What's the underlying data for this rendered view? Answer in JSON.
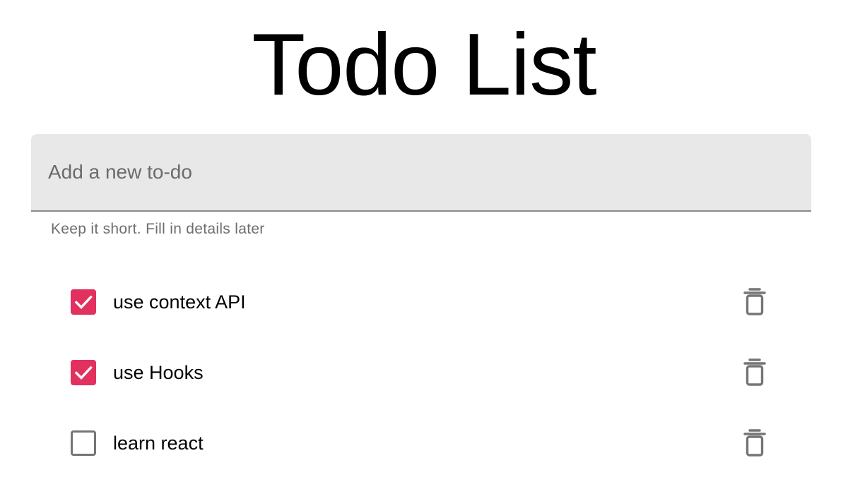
{
  "header": {
    "title": "Todo List"
  },
  "new_todo": {
    "value": "",
    "placeholder": "Add a new to-do",
    "helper": "Keep it short. Fill in details later"
  },
  "todos": [
    {
      "label": "use context API",
      "completed": true
    },
    {
      "label": "use Hooks",
      "completed": true
    },
    {
      "label": "learn react",
      "completed": false
    }
  ],
  "icons": {
    "checkbox_checked": "check-icon",
    "delete": "trash-icon"
  },
  "colors": {
    "accent": "#e2305f",
    "icon_gray": "#757575",
    "input_bg": "#e8e8e8"
  }
}
